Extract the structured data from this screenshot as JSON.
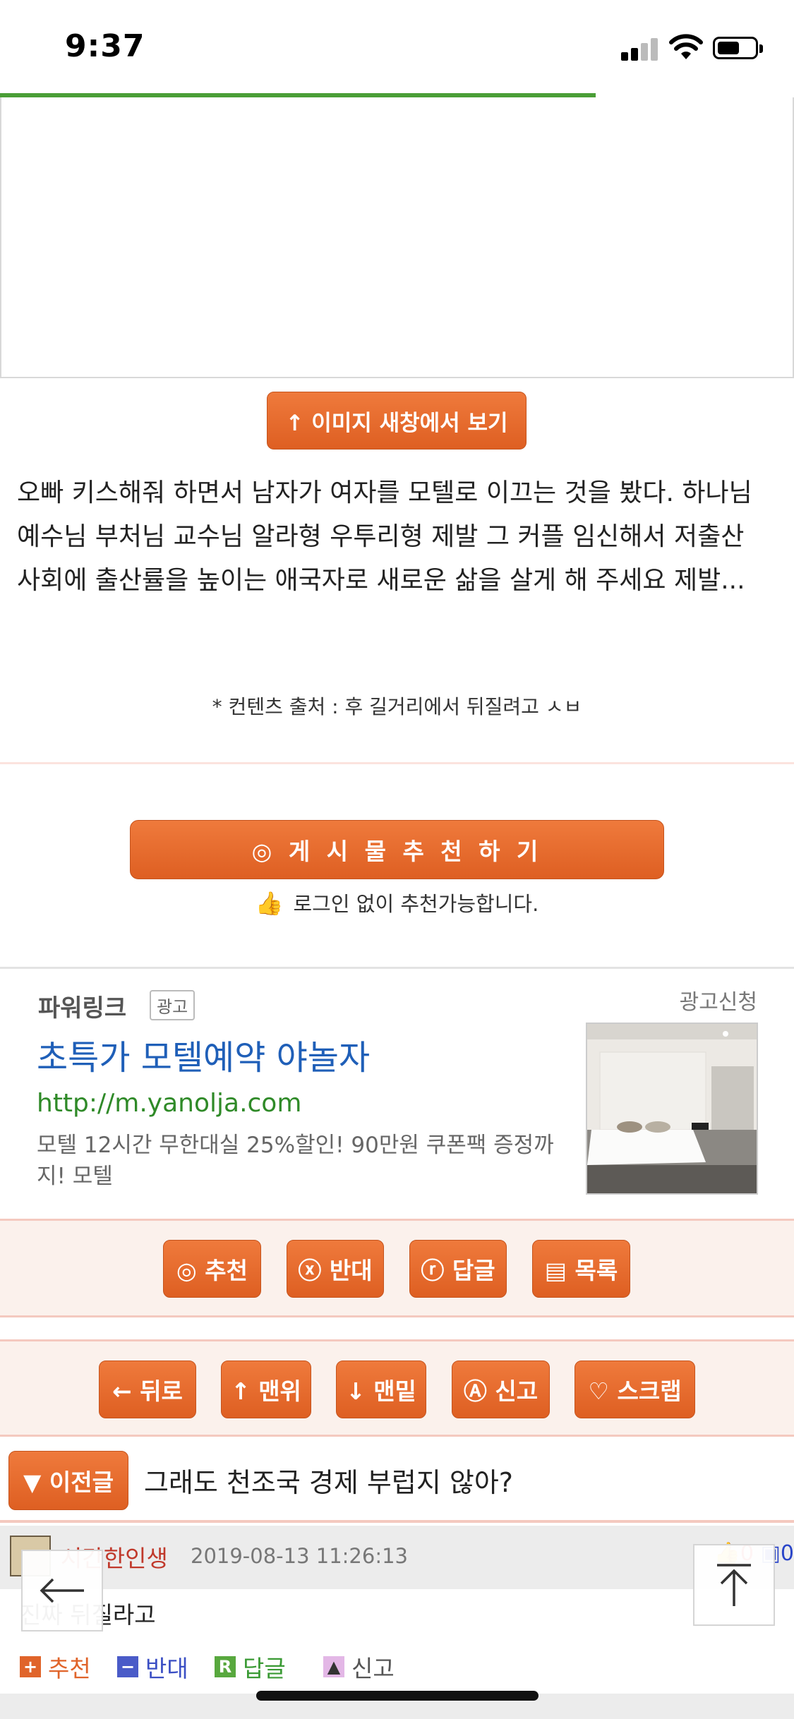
{
  "status_bar": {
    "time": "9:37"
  },
  "page_load": {
    "progress": 0.75
  },
  "content": {
    "open_image_button": "↑ 이미지 새창에서 보기",
    "body_text": "오빠 키스해줘 하면서 남자가 여자를 모텔로 이끄는 것을 봤다. 하나님 예수님 부처님 교수님 알라형 우투리형 제발 그 커플 임신해서 저출산 사회에 출산률을 높이는 애국자로 새로운 삶을 살게 해 주세요 제발...",
    "source": "* 컨텐츠 출처 : 후 길거리에서 뒤질려고 ㅅㅂ"
  },
  "recommend": {
    "button": "◎ 게 시 물   추 천 하 기",
    "note": "로그인 없이 추천가능합니다."
  },
  "powerlink": {
    "label": "파워링크",
    "ad_badge": "광고",
    "apply": "광고신청",
    "title": "초특가 모텔예약 야놀자",
    "url": "http://m.yanolja.com",
    "description": "모텔 12시간 무한대실 25%할인! 90만원 쿠폰팩 증정까지! 모텔"
  },
  "post_actions": [
    {
      "label": "◎ 추천"
    },
    {
      "label": "ⓧ 반대"
    },
    {
      "label": "ⓡ 답글"
    },
    {
      "label": "▤ 목록"
    }
  ],
  "nav_actions": [
    {
      "label": "← 뒤로"
    },
    {
      "label": "↑ 맨위"
    },
    {
      "label": "↓ 맨밑"
    },
    {
      "label": "Ⓐ 신고"
    },
    {
      "label": "♡ 스크랩"
    }
  ],
  "prev_post": {
    "button": "▼ 이전글",
    "title": "그래도 천조국 경제 부럽지 않아?"
  },
  "comment": {
    "author": "시간한인생",
    "date": "2019-08-13 11:26:13",
    "up_count": "0",
    "down_count": "0",
    "text": "진짜 뒤질라고",
    "actions": {
      "recommend": "추천",
      "oppose": "반대",
      "reply": "답글",
      "report": "신고"
    }
  },
  "colors": {
    "accent_orange": "#e0642a",
    "load_bar": "#4a9e36",
    "link_blue": "#1f5fb8",
    "url_green": "#2f8a28"
  },
  "icons": {
    "back": "left-arrow-icon",
    "top": "up-arrow-bar-icon",
    "thumb": "thumbs-up-icon"
  }
}
